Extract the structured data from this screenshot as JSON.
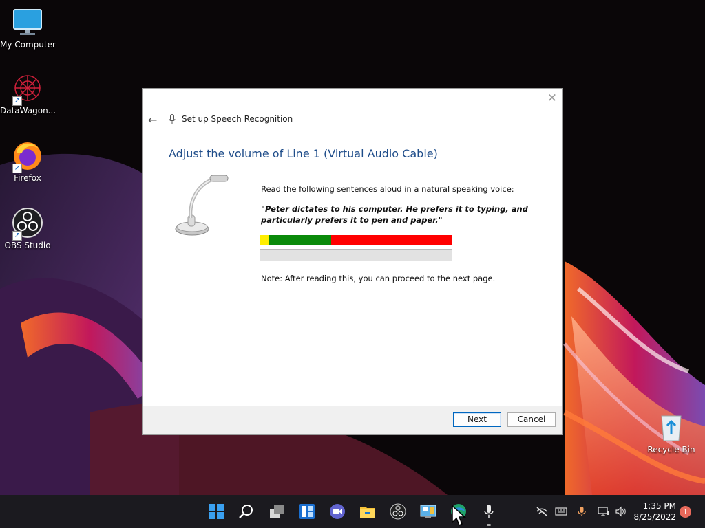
{
  "desktop": {
    "icons": [
      {
        "label": "My Computer",
        "icon": "monitor-icon"
      },
      {
        "label": "DataWagon...",
        "icon": "datawagon-icon"
      },
      {
        "label": "Firefox",
        "icon": "firefox-icon"
      },
      {
        "label": "OBS Studio",
        "icon": "obs-icon"
      },
      {
        "label": "Recycle Bin",
        "icon": "recycle-bin-icon"
      }
    ]
  },
  "dialog": {
    "close_glyph": "✕",
    "back_glyph": "←",
    "title": "Set up Speech Recognition",
    "heading": "Adjust the volume of Line 1 (Virtual Audio Cable)",
    "instruction": "Read the following sentences aloud in a natural speaking voice:",
    "quote": "\"Peter dictates to his computer. He prefers it to typing, and particularly prefers it to pen and paper.\"",
    "note": "Note: After reading this, you can proceed to the next page.",
    "level_meter": {
      "segments": [
        {
          "zone": "low",
          "color": "#ffee00",
          "fraction": 0.05
        },
        {
          "zone": "good",
          "color": "#0a8a0a",
          "fraction": 0.32
        },
        {
          "zone": "high",
          "color": "#ff0000",
          "fraction": 0.63
        }
      ],
      "current_level": 0
    },
    "buttons": {
      "next": "Next",
      "cancel": "Cancel"
    }
  },
  "taskbar": {
    "apps": [
      "start-icon",
      "search-icon",
      "task-view-icon",
      "widgets-icon",
      "teams-chat-icon",
      "file-explorer-icon",
      "obs-icon",
      "control-panel-icon",
      "edge-icon",
      "microphone-icon"
    ],
    "tray": [
      "network-off-icon",
      "keyboard-icon",
      "mic-in-use-icon",
      "display-icon",
      "volume-icon"
    ],
    "time": "1:35 PM",
    "date": "8/25/2022",
    "notification_count": "1"
  },
  "colors": {
    "accent": "#0067c0",
    "heading": "#1f4d8a",
    "taskbar": "#1b1a1f"
  }
}
